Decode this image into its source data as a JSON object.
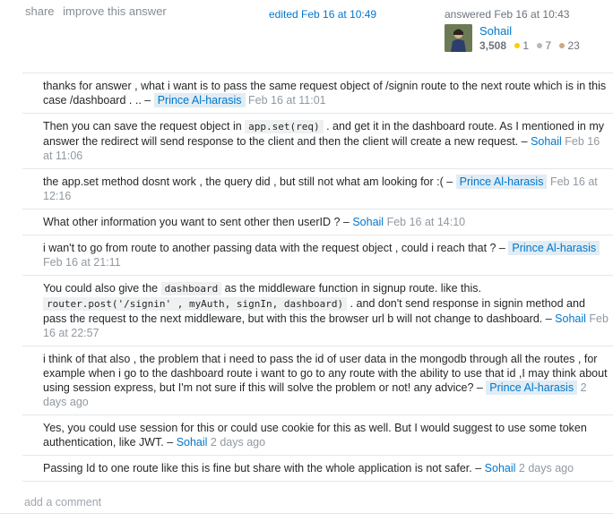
{
  "post_menu": {
    "share": "share",
    "improve": "improve this answer"
  },
  "edited": "edited Feb 16 at 10:49",
  "answered": "answered Feb 16 at 10:43",
  "user": {
    "name": "Sohail",
    "reputation": "3,508",
    "gold": "1",
    "silver": "7",
    "bronze": "23"
  },
  "comments": [
    {
      "parts": [
        {
          "t": "text",
          "v": "thanks for answer , what i want is to pass the same request object of /signin route to the next route which is in this case /dashboard . .. – "
        }
      ],
      "author": "Prince Al-harasis",
      "op": true,
      "date": "Feb 16 at 11:01"
    },
    {
      "parts": [
        {
          "t": "text",
          "v": "Then you can save the request object in "
        },
        {
          "t": "code",
          "v": "app.set(req)"
        },
        {
          "t": "text",
          "v": " . and get it in the dashboard route. As I mentioned in my answer the redirect will send response to the client and then the client will create a new request. – "
        }
      ],
      "author": "Sohail",
      "op": false,
      "date": "Feb 16 at 11:06"
    },
    {
      "parts": [
        {
          "t": "text",
          "v": "the app.set method dosnt work , the query did , but still not what am looking for :( – "
        }
      ],
      "author": "Prince Al-harasis",
      "op": true,
      "date": "Feb 16 at 12:16"
    },
    {
      "parts": [
        {
          "t": "text",
          "v": "What other information you want to sent other then userID ? – "
        }
      ],
      "author": "Sohail",
      "op": false,
      "date": "Feb 16 at 14:10"
    },
    {
      "parts": [
        {
          "t": "text",
          "v": "i wan't to go from route to another passing data with the request object , could i reach that ? – "
        }
      ],
      "author": "Prince Al-harasis",
      "op": true,
      "date": "Feb 16 at 21:11"
    },
    {
      "parts": [
        {
          "t": "text",
          "v": "You could also give the "
        },
        {
          "t": "code",
          "v": "dashboard"
        },
        {
          "t": "text",
          "v": " as the middleware function in signup route. like this. "
        },
        {
          "t": "code",
          "v": "router.post('/signin' , myAuth, signIn, dashboard)"
        },
        {
          "t": "text",
          "v": " . and don't send response in signin method and pass the request to the next middleware, but with this the browser url b will not change to dashboard. – "
        }
      ],
      "author": "Sohail",
      "op": false,
      "date": "Feb 16 at 22:57"
    },
    {
      "parts": [
        {
          "t": "text",
          "v": "i think of that also , the problem that i need to pass the id of user data in the mongodb through all the routes , for example when i go to the dashboard route i want to go to any route with the ability to use that id ,I may think about using session express, but I'm not sure if this will solve the problem or not! any advice? – "
        }
      ],
      "author": "Prince Al-harasis",
      "op": true,
      "date": "2 days ago"
    },
    {
      "parts": [
        {
          "t": "text",
          "v": "Yes, you could use session for this or could use cookie for this as well. But I would suggest to use some token authentication, like JWT. – "
        }
      ],
      "author": "Sohail",
      "op": false,
      "date": "2 days ago"
    },
    {
      "parts": [
        {
          "t": "text",
          "v": "Passing Id to one route like this is fine but share with the whole application is not safer. – "
        }
      ],
      "author": "Sohail",
      "op": false,
      "date": "2 days ago"
    }
  ],
  "add_comment": "add a comment"
}
